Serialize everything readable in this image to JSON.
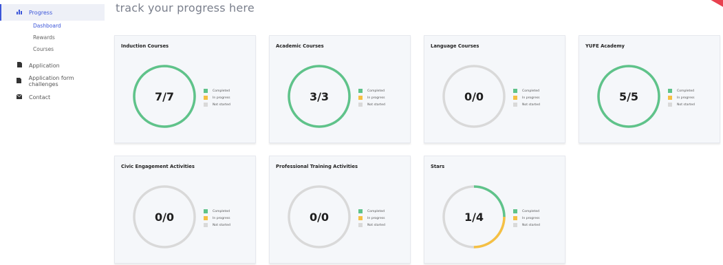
{
  "colors": {
    "completed": "#5fc38a",
    "in_progress": "#f5c044",
    "not_started": "#d9d9d9",
    "accent": "#3b55d9"
  },
  "sidebar": {
    "progress": {
      "label": "Progress",
      "icon": "bar-chart-icon"
    },
    "sub_items": [
      {
        "label": "Dashboard",
        "active": true
      },
      {
        "label": "Rewards",
        "active": false
      },
      {
        "label": "Courses",
        "active": false
      }
    ],
    "application": {
      "label": "Application",
      "icon": "document-icon"
    },
    "challenges": {
      "label": "Application form challenges",
      "icon": "document-icon"
    },
    "contact": {
      "label": "Contact",
      "icon": "envelope-icon"
    }
  },
  "page": {
    "heading": "track your progress here"
  },
  "legend": {
    "completed": "Completed",
    "in_progress": "In progress",
    "not_started": "Not started"
  },
  "cards": [
    {
      "title": "Induction Courses",
      "value": "7/7",
      "completed": 7,
      "in_progress": 0,
      "total": 7
    },
    {
      "title": "Academic Courses",
      "value": "3/3",
      "completed": 3,
      "in_progress": 0,
      "total": 3
    },
    {
      "title": "Language Courses",
      "value": "0/0",
      "completed": 0,
      "in_progress": 0,
      "total": 0
    },
    {
      "title": "YUFE Academy",
      "value": "5/5",
      "completed": 5,
      "in_progress": 0,
      "total": 5
    },
    {
      "title": "Civic Engagement Activities",
      "value": "0/0",
      "completed": 0,
      "in_progress": 0,
      "total": 0
    },
    {
      "title": "Professional Training Activities",
      "value": "0/0",
      "completed": 0,
      "in_progress": 0,
      "total": 0
    },
    {
      "title": "Stars",
      "value": "1/4",
      "completed": 1,
      "in_progress": 1,
      "total": 4
    }
  ]
}
